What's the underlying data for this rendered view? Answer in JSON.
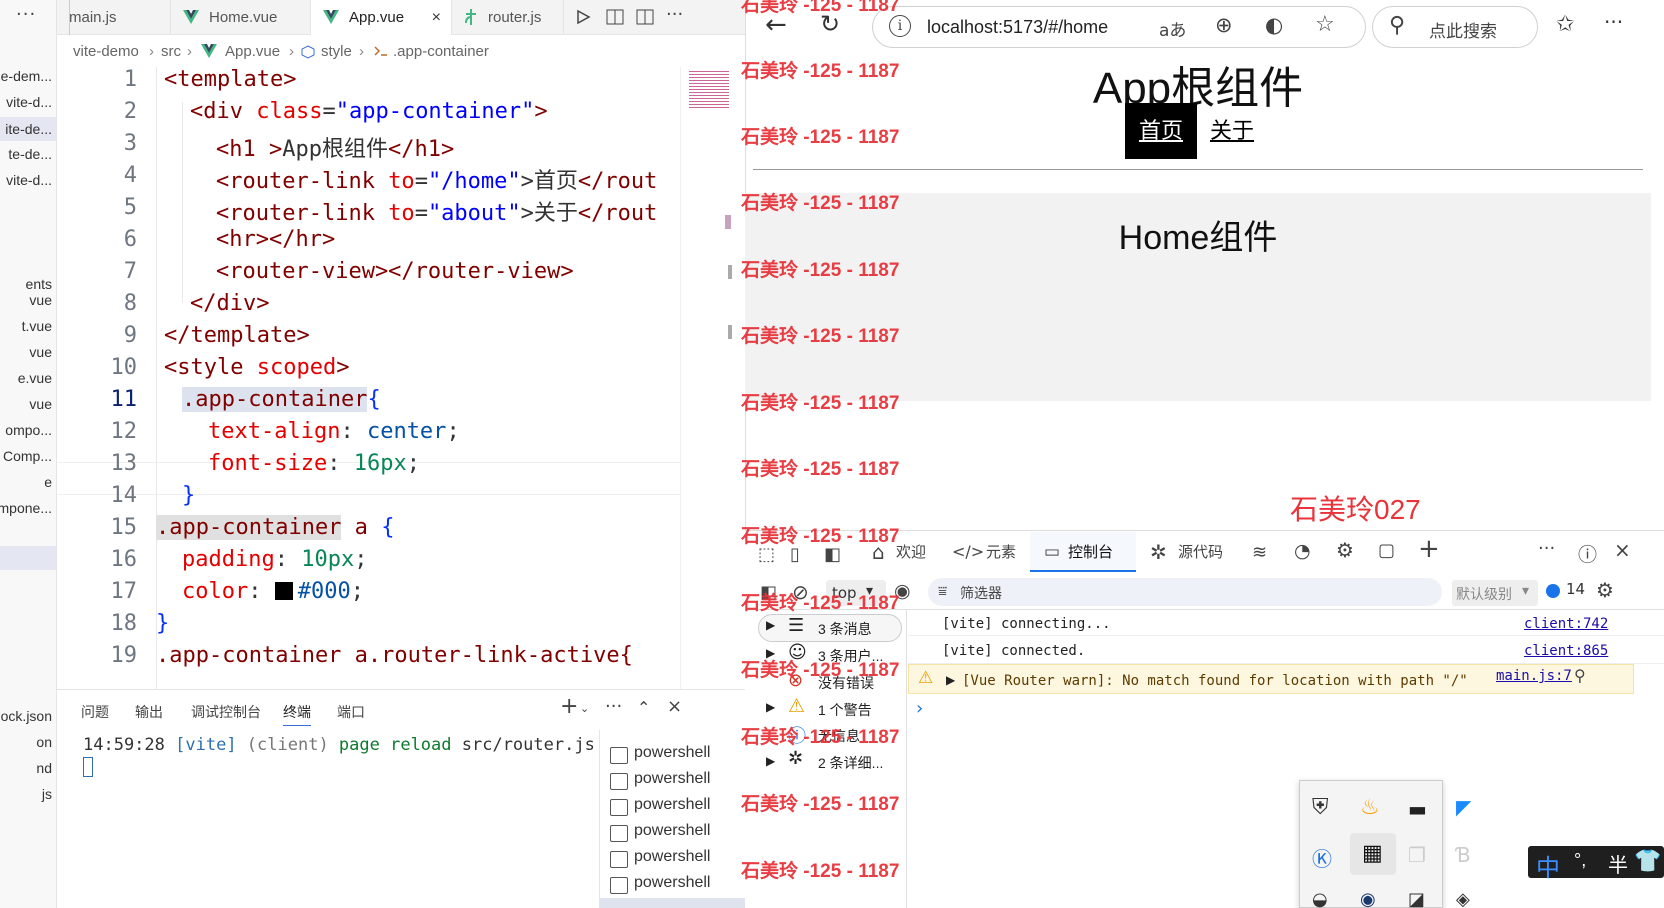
{
  "explorer": {
    "items": [
      "e-dem...",
      "vite-d...",
      "ite-de...",
      "te-de...",
      "vite-d...",
      "ents",
      "vue",
      "t.vue",
      "vue",
      "e.vue",
      "vue",
      "ompo...",
      "Comp...",
      "e",
      "mpone...",
      "ock.json",
      "on",
      "nd",
      "js"
    ]
  },
  "editor": {
    "tabs": [
      {
        "label": "main.js"
      },
      {
        "label": "Home.vue"
      },
      {
        "label": "App.vue"
      },
      {
        "label": "router.js"
      }
    ],
    "close_glyph": "×",
    "breadcrumb": [
      "vite-demo",
      "src",
      "App.vue",
      "style",
      ".app-container"
    ],
    "line_numbers": [
      "1",
      "2",
      "3",
      "4",
      "5",
      "6",
      "7",
      "8",
      "9",
      "10",
      "11",
      "12",
      "13",
      "14",
      "15",
      "16",
      "17",
      "18",
      "19"
    ],
    "code": {
      "l1_tag": "<template>",
      "l2_open": "<div ",
      "l2_attr": "class",
      "l2_eq": "=",
      "l2_val": "\"app-container\"",
      "l2_close": ">",
      "l3_open": "<h1 >",
      "l3_text": "App根组件",
      "l3_close": "</h1>",
      "l4_open": "<router-link ",
      "l4_attr": "to",
      "l4_val": "\"/home\"",
      "l4_text": "首页",
      "l4_close": "</rout",
      "l5_open": "<router-link ",
      "l5_attr": "to",
      "l5_val": "\"about\"",
      "l5_text": "关于",
      "l5_close": "</rout",
      "l6": "<hr></hr>",
      "l7": "<router-view></router-view>",
      "l8": "</div>",
      "l9": "</template>",
      "l10_tag": "<style ",
      "l10_attr": "scoped",
      "l10_close": ">",
      "l11_sel": ".app-container",
      "l11_brace": "{",
      "l12_prop": "text-align",
      "l12_val": "center",
      "l13_prop": "font-size",
      "l13_val": "16px",
      "l14": "}",
      "l15_sel": ".app-container",
      "l15_a": " a ",
      "l15_brace": "{",
      "l16_prop": "padding",
      "l16_val": "10px",
      "l17_prop": "color",
      "l17_val": "#000",
      "l18": "}",
      "l19": ".app-container a.router-link-active{"
    }
  },
  "panel": {
    "tabs": [
      "问题",
      "输出",
      "调试控制台",
      "终端",
      "端口"
    ],
    "active_tab": "终端",
    "terminal": {
      "time": "14:59:28",
      "tag": "[vite]",
      "msg1": " (client) ",
      "msg2": "page reload",
      "msg3": " src/router.js"
    },
    "shells": [
      "powershell",
      "powershell",
      "powershell",
      "powershell",
      "powershell",
      "powershell"
    ]
  },
  "browser": {
    "url": "localhost:5173/#/home",
    "search_placeholder": "点此搜索",
    "page": {
      "h1": "App根组件",
      "nav_home": "首页",
      "nav_about": "关于",
      "home_title": "Home组件",
      "author": "石美玲027"
    },
    "devtools": {
      "tabs": [
        "欢迎",
        "元素",
        "控制台",
        "源代码"
      ],
      "active_tab": "控制台",
      "context": "top",
      "filter_placeholder": "筛选器",
      "level": "默认级别",
      "issues_count": "14",
      "sidebar": [
        "3 条消息",
        "3 条用户...",
        "没有错误",
        "1 个警告",
        "无信息",
        "2 条详细..."
      ],
      "logs": [
        {
          "text": "[vite] connecting...",
          "src": "client:742"
        },
        {
          "text": "[vite] connected.",
          "src": "client:865"
        },
        {
          "text": "[Vue Router warn]: No match found for location with path \"/\"",
          "src": "main.js:7"
        }
      ]
    }
  },
  "watermark": "石美玲 -125 - 1187",
  "ime": {
    "lang": "中",
    "punct": "°,",
    "width": "半"
  },
  "colors": {
    "link": "#1a0dab",
    "active_tab_border": "#1a73e8",
    "watermark": "#e8333a",
    "vue_green": "#41b883"
  }
}
